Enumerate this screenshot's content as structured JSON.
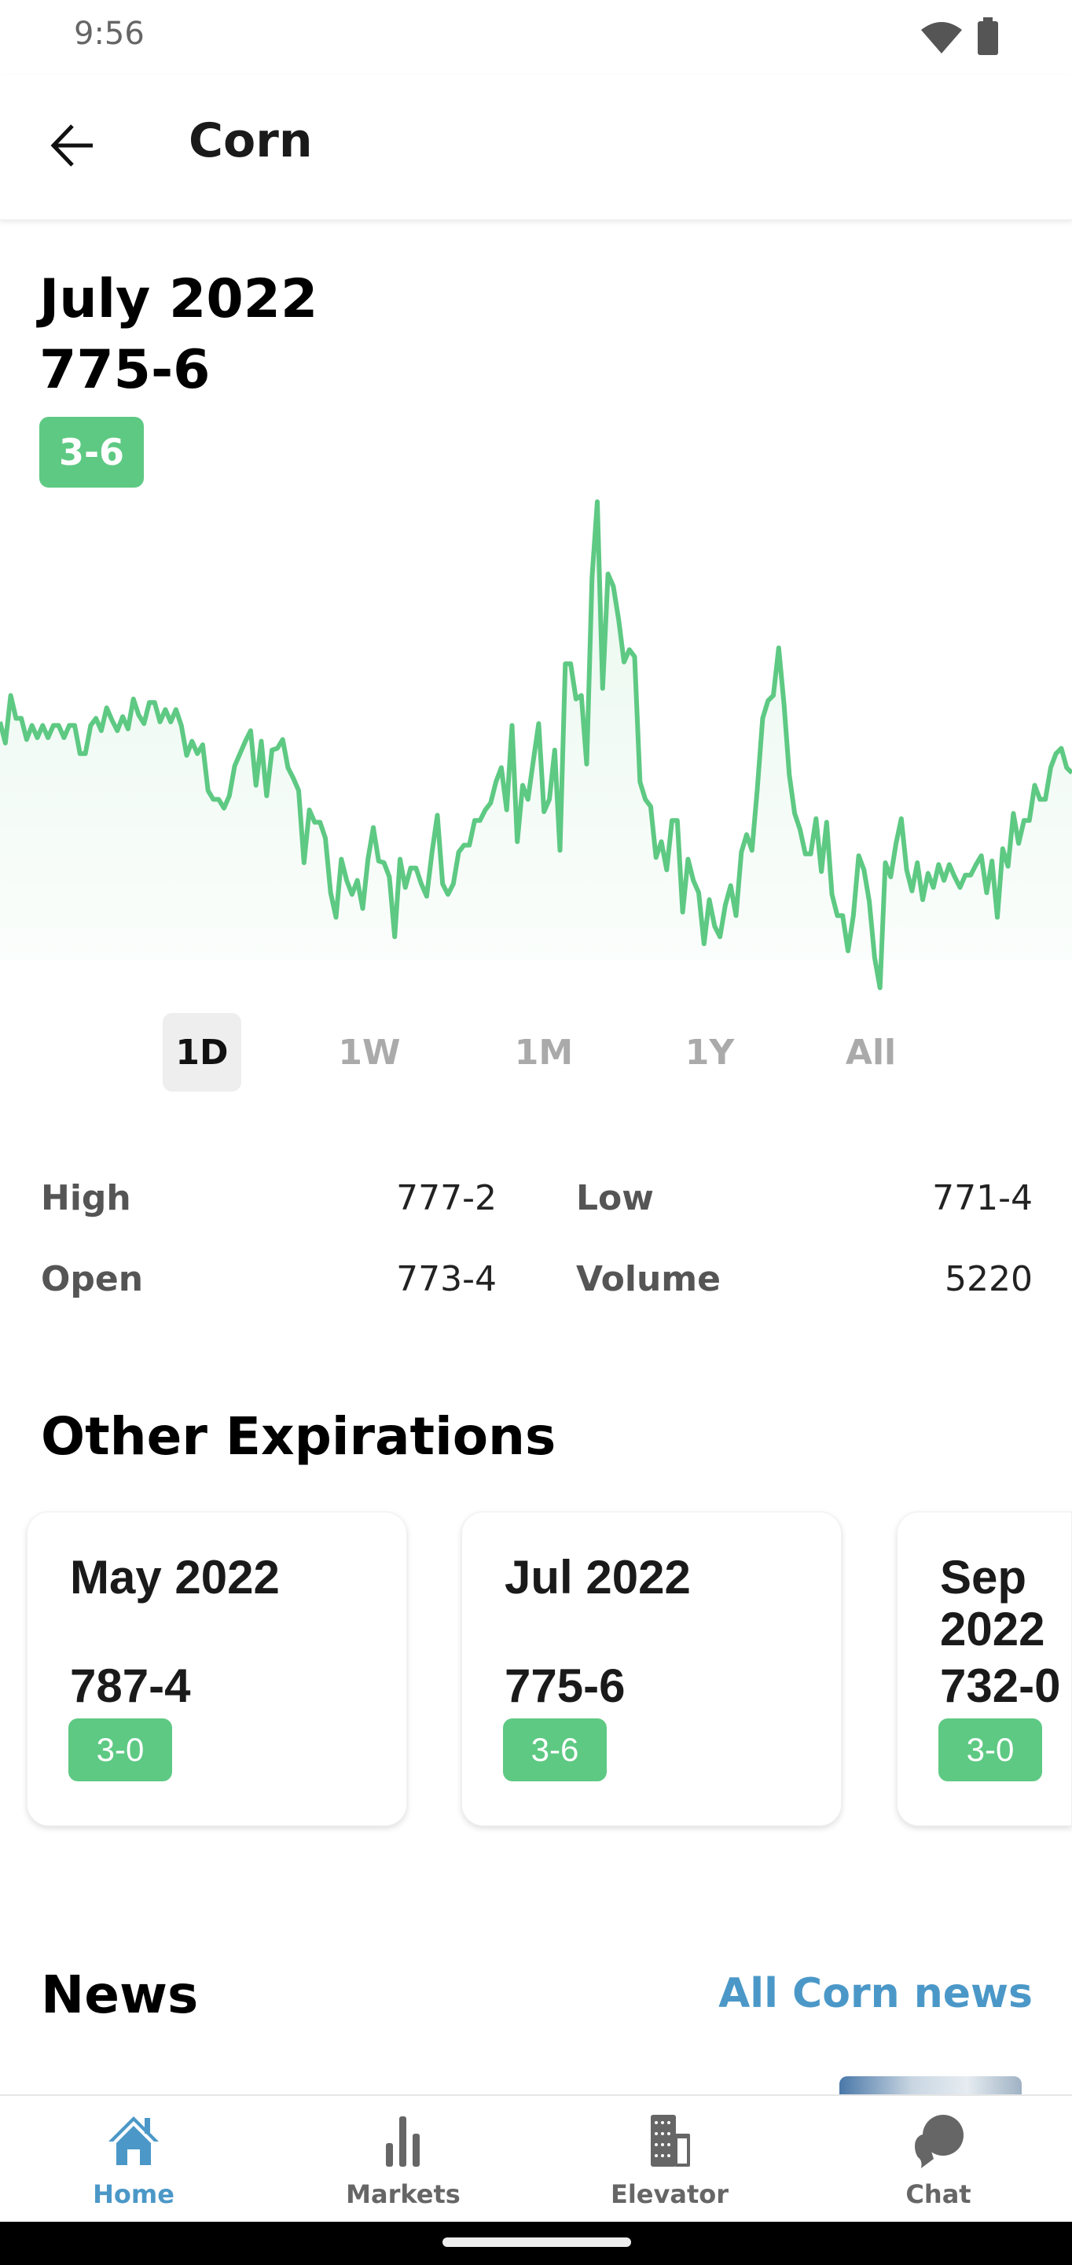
{
  "status_bar": {
    "time": "9:56",
    "icons": [
      "wifi-icon",
      "battery-icon"
    ]
  },
  "app_bar": {
    "title": "Corn",
    "back_icon": "arrow-left-icon"
  },
  "contract": {
    "month": "July 2022",
    "price": "775-6",
    "change": "3-6",
    "change_color": "#5ec983"
  },
  "chart_data": {
    "type": "area",
    "title": "",
    "xlabel": "",
    "ylabel": "",
    "grid": false,
    "line_color": "#5ec983",
    "values": [
      79,
      73,
      86.5,
      80,
      80,
      74,
      78,
      74.5,
      78,
      74.5,
      78,
      78,
      74.5,
      78,
      78,
      70,
      70,
      78,
      80,
      76.5,
      83,
      79.5,
      76.5,
      80.5,
      77,
      85.5,
      81,
      78.5,
      84.5,
      84.5,
      79,
      82.5,
      79,
      82.5,
      78,
      69.5,
      73.5,
      70,
      72.5,
      59.5,
      57,
      57,
      54.5,
      58,
      66.5,
      70,
      73.5,
      76.5,
      61,
      73.5,
      58,
      71,
      71.5,
      74,
      66,
      63,
      59.5,
      39,
      54,
      50.5,
      50.5,
      46,
      30.5,
      23.5,
      40,
      34,
      30,
      34,
      26,
      40,
      49,
      39.5,
      39,
      35,
      18,
      40,
      32,
      37.5,
      37.5,
      33,
      29.5,
      42,
      52.5,
      33,
      30,
      33,
      42,
      44,
      44,
      51,
      51,
      54,
      56,
      62,
      66,
      54,
      78,
      45,
      61,
      57,
      68,
      78.5,
      53.5,
      57,
      71,
      42.5,
      95.5,
      95.5,
      85.5,
      86.5,
      67,
      120,
      141.5,
      88.5,
      121,
      117.5,
      108,
      96,
      99.5,
      97.5,
      62,
      57,
      55,
      40.5,
      45,
      37,
      51,
      51,
      25,
      40,
      34,
      30.5,
      16,
      28.5,
      21,
      18,
      27,
      32.5,
      24,
      42,
      47,
      42.5,
      60,
      80,
      85,
      86.5,
      100,
      84,
      64,
      53,
      48.5,
      41.5,
      41.5,
      51.5,
      36.5,
      50.5,
      30,
      24,
      24,
      14,
      24,
      41,
      37,
      28,
      12,
      3.5,
      39,
      35,
      44.5,
      51.5,
      37,
      31,
      39,
      28.5,
      36,
      32,
      38.5,
      34,
      38.5,
      35,
      32,
      35.5,
      35.5,
      38.5,
      41,
      30.5,
      39.5,
      23.5,
      43,
      38,
      53,
      44.5,
      51,
      51,
      61,
      57,
      57,
      66,
      70,
      71.5,
      66,
      64.5
    ]
  },
  "timeframes": [
    {
      "label": "1D",
      "active": true
    },
    {
      "label": "1W",
      "active": false
    },
    {
      "label": "1M",
      "active": false
    },
    {
      "label": "1Y",
      "active": false
    },
    {
      "label": "All",
      "active": false
    }
  ],
  "stats": {
    "high_label": "High",
    "high": "777-2",
    "low_label": "Low",
    "low": "771-4",
    "open_label": "Open",
    "open": "773-4",
    "volume_label": "Volume",
    "volume": "5220"
  },
  "other_expirations": {
    "title": "Other Expirations",
    "cards": [
      {
        "month": "May 2022",
        "price": "787-4",
        "change": "3-0"
      },
      {
        "month": "Jul 2022",
        "price": "775-6",
        "change": "3-6"
      },
      {
        "month": "Sep 2022",
        "price": "732-0",
        "change": "3-0"
      }
    ]
  },
  "news": {
    "title": "News",
    "link": "All Corn news",
    "link_color": "#4b98c8"
  },
  "bottom_nav": {
    "active_color": "#4b98c8",
    "items": [
      {
        "label": "Home",
        "icon": "home-icon",
        "active": true
      },
      {
        "label": "Markets",
        "icon": "bar-chart-icon",
        "active": false
      },
      {
        "label": "Elevator",
        "icon": "building-icon",
        "active": false
      },
      {
        "label": "Chat",
        "icon": "chat-icon",
        "active": false
      }
    ]
  }
}
